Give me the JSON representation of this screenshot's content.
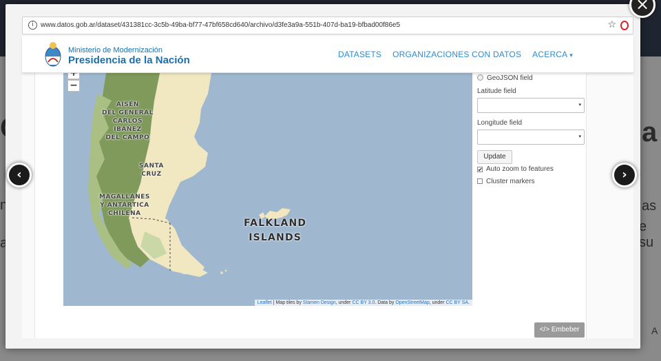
{
  "background": {
    "left_fragments": [
      "a",
      "i",
      "C",
      "n"
    ],
    "right_big": "a",
    "right_lines": [
      "as",
      "e su",
      "A"
    ]
  },
  "browser": {
    "url": "www.datos.gob.ar/dataset/431381cc-3c5b-49ba-bf77-47bf658cd640/archivo/d3fe3a9a-551b-407d-ba19-bfbad00f86e5",
    "info_icon": "i",
    "star_icon": "☆"
  },
  "header": {
    "logo_line1": "Ministerio de Modernización",
    "logo_line2": "Presidencia de la Nación",
    "nav": [
      "DATASETS",
      "ORGANIZACIONES CON DATOS",
      "ACERCA"
    ],
    "acerca_caret": "▾"
  },
  "map": {
    "zoom_in": "+",
    "zoom_out": "−",
    "region_labels": [
      [
        "AISÉN",
        "DEL GENERAL",
        "CARLOS",
        "IBÁÑEZ",
        "DEL CAMPO"
      ],
      [
        "SANTA",
        "CRUZ"
      ],
      [
        "MAGALLANES",
        "Y ANTÁRTICA",
        "CHILENA"
      ]
    ],
    "falkland": [
      "FALKLAND",
      "ISLANDS"
    ],
    "attribution": {
      "leaflet": "Leaflet",
      "sep1": " | Map tiles by ",
      "stamen": "Stamen Design",
      "sep2": ", under ",
      "ccby30": "CC BY 3.0",
      "sep3": ". Data by ",
      "osm": "OpenStreetMap",
      "sep4": ", under ",
      "ccbysa": "CC BY SA",
      "end": "."
    },
    "colors": {
      "water": "#9fb8cf",
      "land": "#f1e7c1",
      "forest": "#7f9a5a"
    }
  },
  "form": {
    "geojson_label": "GeoJSON field",
    "latitude_label": "Latitude field",
    "latitude_value": "",
    "longitude_label": "Longitude field",
    "longitude_value": "",
    "caret": "▾",
    "update_label": "Update",
    "auto_zoom_label": "Auto zoom to features",
    "auto_zoom_checked": true,
    "check_mark": "✔",
    "cluster_label": "Cluster markers",
    "cluster_checked": false
  },
  "embed_label": "</> Embeber",
  "lightbox": {
    "close_icon": "×",
    "prev_icon": "‹",
    "next_icon": "›"
  }
}
